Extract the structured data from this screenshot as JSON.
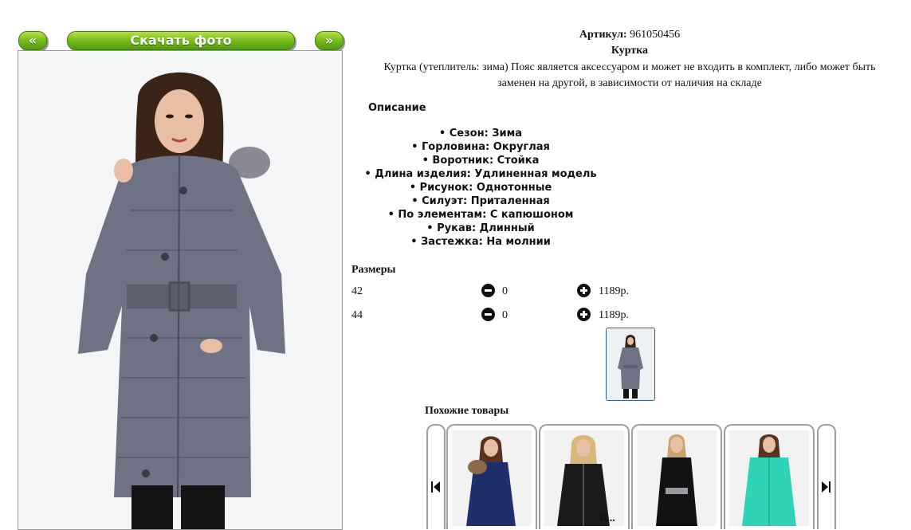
{
  "nav": {
    "prev_label": "«",
    "download_label": "Скачать фото",
    "next_label": "»"
  },
  "product": {
    "article_label": "Артикул:",
    "article_value": "961050456",
    "name": "Куртка",
    "description_line1": "Куртка (утеплитель: зима) Пояс является аксессуаром и может не входить в комплект, либо может быть",
    "description_line2": "заменен на другой, в зависимости от наличия на складе"
  },
  "description": {
    "title": "Описание",
    "properties": [
      "• Сезон: Зима",
      "• Горловина: Округлая",
      "• Воротник: Стойка",
      "• Длина изделия: Удлиненная модель",
      "• Рисунок: Однотонные",
      "• Силуэт: Приталенная",
      "• По элементам: С капюшоном",
      "• Рукав: Длинный",
      "• Застежка: На молнии"
    ]
  },
  "sizes": {
    "title": "Размеры",
    "rows": [
      {
        "size": "42",
        "qty": "0",
        "price": "1189р."
      },
      {
        "size": "44",
        "qty": "0",
        "price": "1189р."
      }
    ]
  },
  "similar": {
    "title": "Похожие товары",
    "prev_icon": "skip-previous-icon",
    "next_icon": "skip-next-icon",
    "cards": [
      {
        "jacket_color": "#1f2f6b"
      },
      {
        "jacket_color": "#1a1a1a"
      },
      {
        "jacket_color": "#111111"
      },
      {
        "jacket_color": "#2fd3b8"
      }
    ],
    "bottom_text": "Б..."
  },
  "colors": {
    "button_green": "#6fb21a",
    "jacket_main": "#6f7184",
    "thumb_border": "#2c5f86"
  }
}
